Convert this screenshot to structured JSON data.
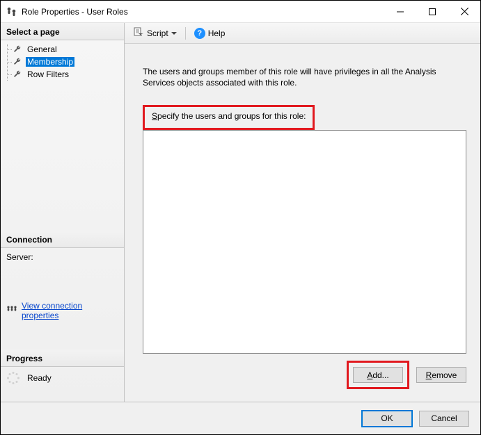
{
  "window": {
    "title": "Role Properties - User Roles"
  },
  "sidebar": {
    "select_page": "Select a page",
    "items": [
      {
        "label": "General"
      },
      {
        "label": "Membership"
      },
      {
        "label": "Row Filters"
      }
    ]
  },
  "connection": {
    "heading": "Connection",
    "server_label": "Server:",
    "view_props": "View connection properties"
  },
  "progress": {
    "heading": "Progress",
    "status": "Ready"
  },
  "toolbar": {
    "script_label": "Script",
    "help_label": "Help"
  },
  "main": {
    "description": "The users and groups member of this role will have privileges in all the Analysis Services objects associated with this role.",
    "specify_label": "Specify the users and groups for this role:",
    "add_label": "Add...",
    "remove_label": "Remove"
  },
  "footer": {
    "ok": "OK",
    "cancel": "Cancel"
  }
}
